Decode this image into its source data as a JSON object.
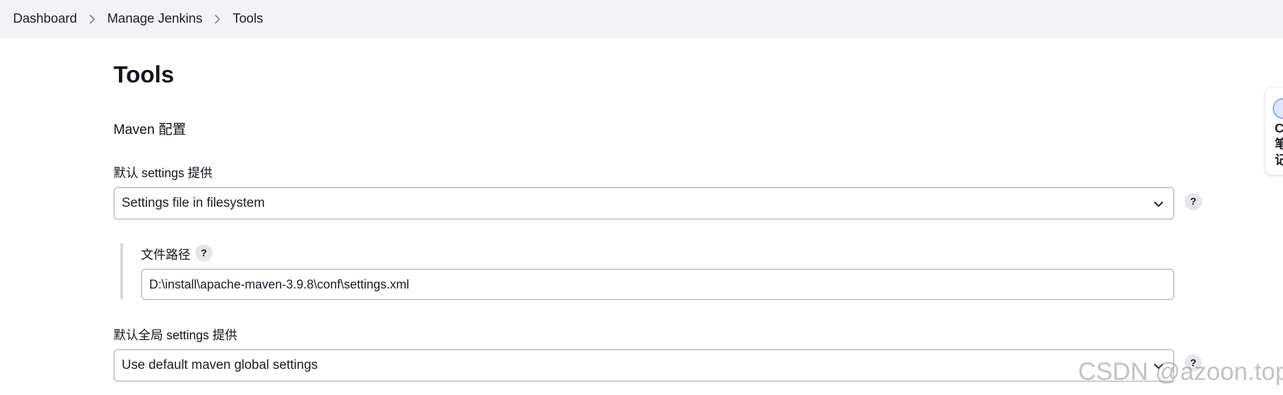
{
  "breadcrumb": {
    "items": [
      "Dashboard",
      "Manage Jenkins",
      "Tools"
    ]
  },
  "page": {
    "title": "Tools"
  },
  "maven_config": {
    "section_title": "Maven 配置",
    "default_settings": {
      "label": "默认 settings 提供",
      "selected": "Settings file in filesystem"
    },
    "file_path": {
      "label": "文件路径",
      "value": "D:\\install\\apache-maven-3.9.8\\conf\\settings.xml"
    },
    "global_settings": {
      "label": "默认全局 settings 提供",
      "selected": "Use default maven global settings"
    }
  },
  "help": {
    "glyph": "?"
  },
  "side_widget": {
    "text": "C笔记"
  },
  "watermark": {
    "text": "CSDN @azoon.top"
  },
  "colors": {
    "breadcrumb_bg": "#f3f3f6",
    "border": "#c9ccd6",
    "help_bg": "#e6e6ea"
  }
}
